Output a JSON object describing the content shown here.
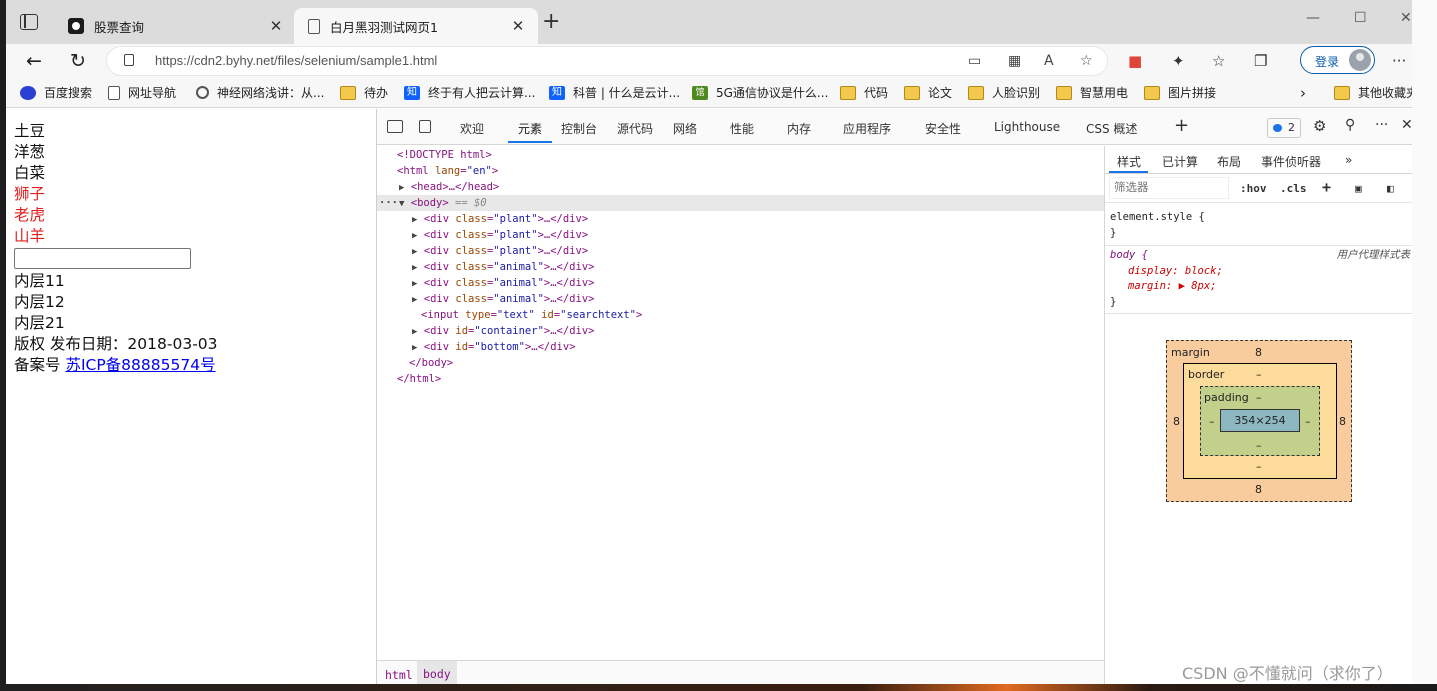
{
  "tabs": [
    {
      "title": "股票查询",
      "icon": "stock-site-icon",
      "active": false
    },
    {
      "title": "白月黑羽测试网页1",
      "icon": "page-icon",
      "active": true
    }
  ],
  "address_bar": {
    "url": "https://cdn2.byhy.net/files/selenium/sample1.html"
  },
  "profile": {
    "login_label": "登录"
  },
  "bookmarks": [
    {
      "label": "百度搜索",
      "icon": "baidu-icon"
    },
    {
      "label": "网址导航",
      "icon": "page-icon"
    },
    {
      "label": "神经网络浅讲：从...",
      "icon": "swirl-icon"
    },
    {
      "label": "待办",
      "icon": "folder-icon"
    },
    {
      "label": "终于有人把云计算...",
      "icon": "zhihu-icon"
    },
    {
      "label": "科普 | 什么是云计...",
      "icon": "zhihu-icon"
    },
    {
      "label": "5G通信协议是什么...",
      "icon": "green-icon"
    },
    {
      "label": "代码",
      "icon": "folder-icon"
    },
    {
      "label": "论文",
      "icon": "folder-icon"
    },
    {
      "label": "人脸识别",
      "icon": "folder-icon"
    },
    {
      "label": "智慧用电",
      "icon": "folder-icon"
    },
    {
      "label": "图片拼接",
      "icon": "folder-icon"
    }
  ],
  "bookmarks_other": "其他收藏夹",
  "page": {
    "plants": [
      "土豆",
      "洋葱",
      "白菜"
    ],
    "animals": [
      "狮子",
      "老虎",
      "山羊"
    ],
    "inner": [
      "内层11",
      "内层12",
      "内层21"
    ],
    "copyright": "版权 发布日期：2018-03-03",
    "icp_prefix": "备案号 ",
    "icp_link": "苏ICP备88885574号",
    "colors": {
      "animal": "#e02020",
      "link": "#0000ee"
    }
  },
  "devtools": {
    "tabs": [
      "欢迎",
      "元素",
      "控制台",
      "源代码",
      "网络",
      "性能",
      "内存",
      "应用程序",
      "安全性",
      "Lighthouse",
      "CSS 概述"
    ],
    "active_tab": "元素",
    "issues_count": "2",
    "dom": {
      "doctype": "<!DOCTYPE html>",
      "html_open_tag": "<html",
      "html_lang_attr": "lang",
      "html_lang_val": "\"en\"",
      "head": "<head>…</head>",
      "body_tag": "<body>",
      "body_marker": "== $0",
      "div_tag": "<div",
      "class_attr": "class",
      "id_attr": "id",
      "div_close": ">…</div>",
      "plant_val": "\"plant\"",
      "animal_val": "\"animal\"",
      "input_tag": "<input",
      "input_type_attr": "type",
      "input_type_val": "\"text\"",
      "input_id_val": "\"searchtext\"",
      "container_val": "\"container\"",
      "bottom_val": "\"bottom\"",
      "body_close": "</body>",
      "html_close": "</html>"
    },
    "breadcrumb": [
      "html",
      "body"
    ],
    "styles_tabs": [
      "样式",
      "已计算",
      "布局",
      "事件侦听器"
    ],
    "filter_placeholder": "筛选器",
    "filter_buttons": [
      ":hov",
      ".cls"
    ],
    "rules": {
      "element_style": "element.style {",
      "close_brace": "}",
      "body_selector": "body {",
      "ua_label": "用户代理样式表",
      "display_prop": "display: block;",
      "margin_prop": "margin: ▶ 8px;"
    },
    "box_model": {
      "margin_label": "margin",
      "border_label": "border",
      "padding_label": "padding",
      "margin_top": "8",
      "margin_bottom": "8",
      "margin_left": "8",
      "margin_right": "8",
      "border_value": "–",
      "padding_value": "–",
      "content": "354×254"
    }
  },
  "watermark": "CSDN @不懂就问（求你了）"
}
